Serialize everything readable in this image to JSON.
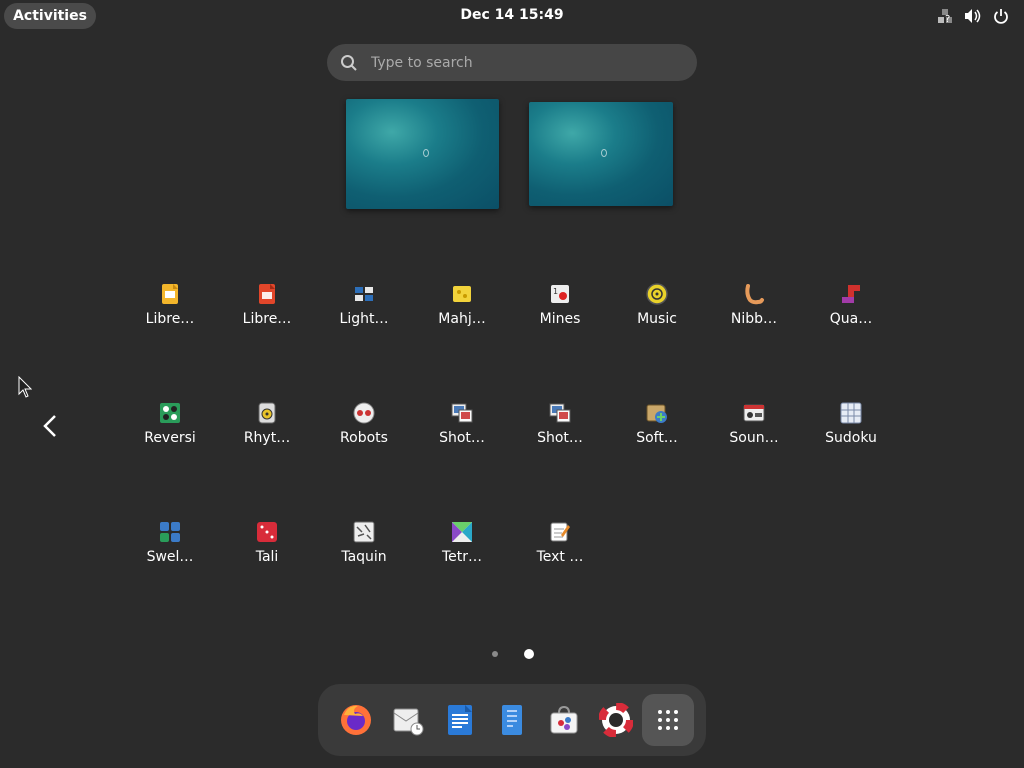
{
  "topbar": {
    "activities": "Activities",
    "clock": "Dec 14  15:49",
    "icons": [
      "network-question-icon",
      "volume-icon",
      "power-icon"
    ]
  },
  "search": {
    "placeholder": "Type to search"
  },
  "apps": [
    {
      "label": "Libre…",
      "icon": "libreoffice-impress-icon"
    },
    {
      "label": "Libre…",
      "icon": "libreoffice-writer-icon"
    },
    {
      "label": "Light…",
      "icon": "lightsoff-icon"
    },
    {
      "label": "Mahj…",
      "icon": "mahjongg-icon"
    },
    {
      "label": "Mines",
      "icon": "mines-icon"
    },
    {
      "label": "Music",
      "icon": "music-icon"
    },
    {
      "label": "Nibb…",
      "icon": "nibbles-icon"
    },
    {
      "label": "Qua…",
      "icon": "quadrapassel-icon"
    },
    {
      "label": "Reversi",
      "icon": "reversi-icon"
    },
    {
      "label": "Rhyt…",
      "icon": "rhythmbox-icon"
    },
    {
      "label": "Robots",
      "icon": "robots-icon"
    },
    {
      "label": "Shot…",
      "icon": "shotwell-icon"
    },
    {
      "label": "Shot…",
      "icon": "shotwell-viewer-icon"
    },
    {
      "label": "Soft…",
      "icon": "software-icon"
    },
    {
      "label": "Soun…",
      "icon": "sound-recorder-icon"
    },
    {
      "label": "Sudoku",
      "icon": "sudoku-icon"
    },
    {
      "label": "Swel…",
      "icon": "swell-foop-icon"
    },
    {
      "label": "Tali",
      "icon": "tali-icon"
    },
    {
      "label": "Taquin",
      "icon": "taquin-icon"
    },
    {
      "label": "Tetr…",
      "icon": "tetravex-icon"
    },
    {
      "label": "Text …",
      "icon": "text-editor-icon"
    }
  ],
  "pagination": {
    "current": 2,
    "total": 2
  },
  "dock": [
    {
      "icon": "firefox-icon"
    },
    {
      "icon": "evolution-mail-icon"
    },
    {
      "icon": "libreoffice-writer-icon"
    },
    {
      "icon": "files-document-icon"
    },
    {
      "icon": "software-store-icon"
    },
    {
      "icon": "help-lifebuoy-icon"
    },
    {
      "icon": "show-apps-grid-icon"
    }
  ],
  "colors": {
    "background": "#2b2b2b",
    "panel": "#3a3a3a",
    "accent_wallpaper": "#1b7d8a"
  }
}
